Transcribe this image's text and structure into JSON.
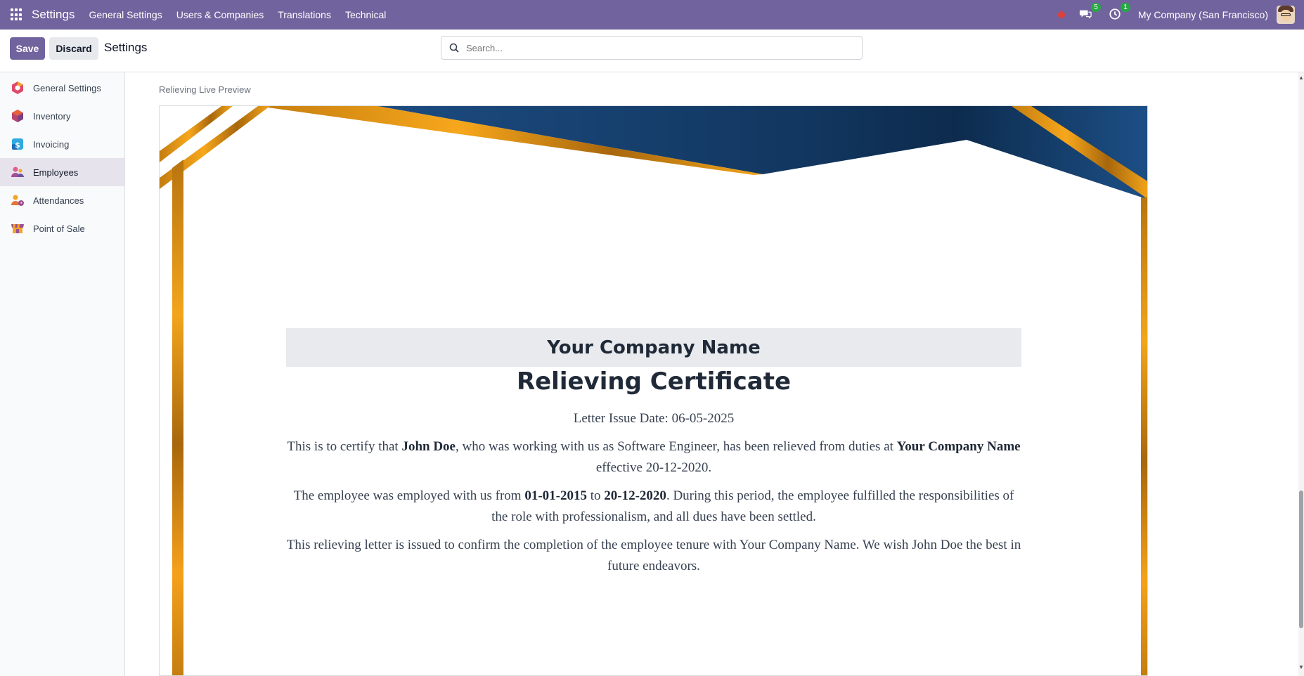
{
  "topbar": {
    "brand": "Settings",
    "menu": [
      "General Settings",
      "Users & Companies",
      "Translations",
      "Technical"
    ],
    "messages_badge": "5",
    "activity_badge": "1",
    "company": "My Company (San Francisco)"
  },
  "control": {
    "save_label": "Save",
    "discard_label": "Discard",
    "title": "Settings",
    "search_placeholder": "Search..."
  },
  "sidebar": {
    "items": [
      {
        "label": "General Settings",
        "icon": "general-settings-icon",
        "color": "#e04a6a"
      },
      {
        "label": "Inventory",
        "icon": "inventory-icon",
        "color": "#e85f3c"
      },
      {
        "label": "Invoicing",
        "icon": "invoicing-icon",
        "color": "#2fa9e0"
      },
      {
        "label": "Employees",
        "icon": "employees-icon",
        "color": "#a44e96"
      },
      {
        "label": "Attendances",
        "icon": "attendances-icon",
        "color": "#f0a42a"
      },
      {
        "label": "Point of Sale",
        "icon": "point-of-sale-icon",
        "color": "#9b4f8f"
      }
    ],
    "active_index": 3
  },
  "preview": {
    "label": "Relieving Live Preview",
    "company_name": "Your Company Name",
    "title": "Relieving Certificate",
    "issue_date_line": "Letter Issue Date: 06-05-2025",
    "p1_a": "This is to certify that ",
    "p1_name": "John Doe",
    "p1_b": ", who was working with us as Software Engineer, has been relieved from duties at ",
    "p1_company": "Your Company Name",
    "p1_c": " effective 20-12-2020.",
    "p2_a": "The employee was employed with us from ",
    "p2_from": "01-01-2015",
    "p2_b": " to ",
    "p2_to": "20-12-2020",
    "p2_c": ". During this period, the employee fulfilled the responsibilities of the role with professionalism, and all dues have been settled.",
    "p3": "This relieving letter is issued to confirm the completion of the employee tenure with Your Company Name. We wish John Doe the best in future endeavors."
  },
  "colors": {
    "navbar": "#71639e",
    "gold": "#f5a11a",
    "navy": "#173a66"
  }
}
